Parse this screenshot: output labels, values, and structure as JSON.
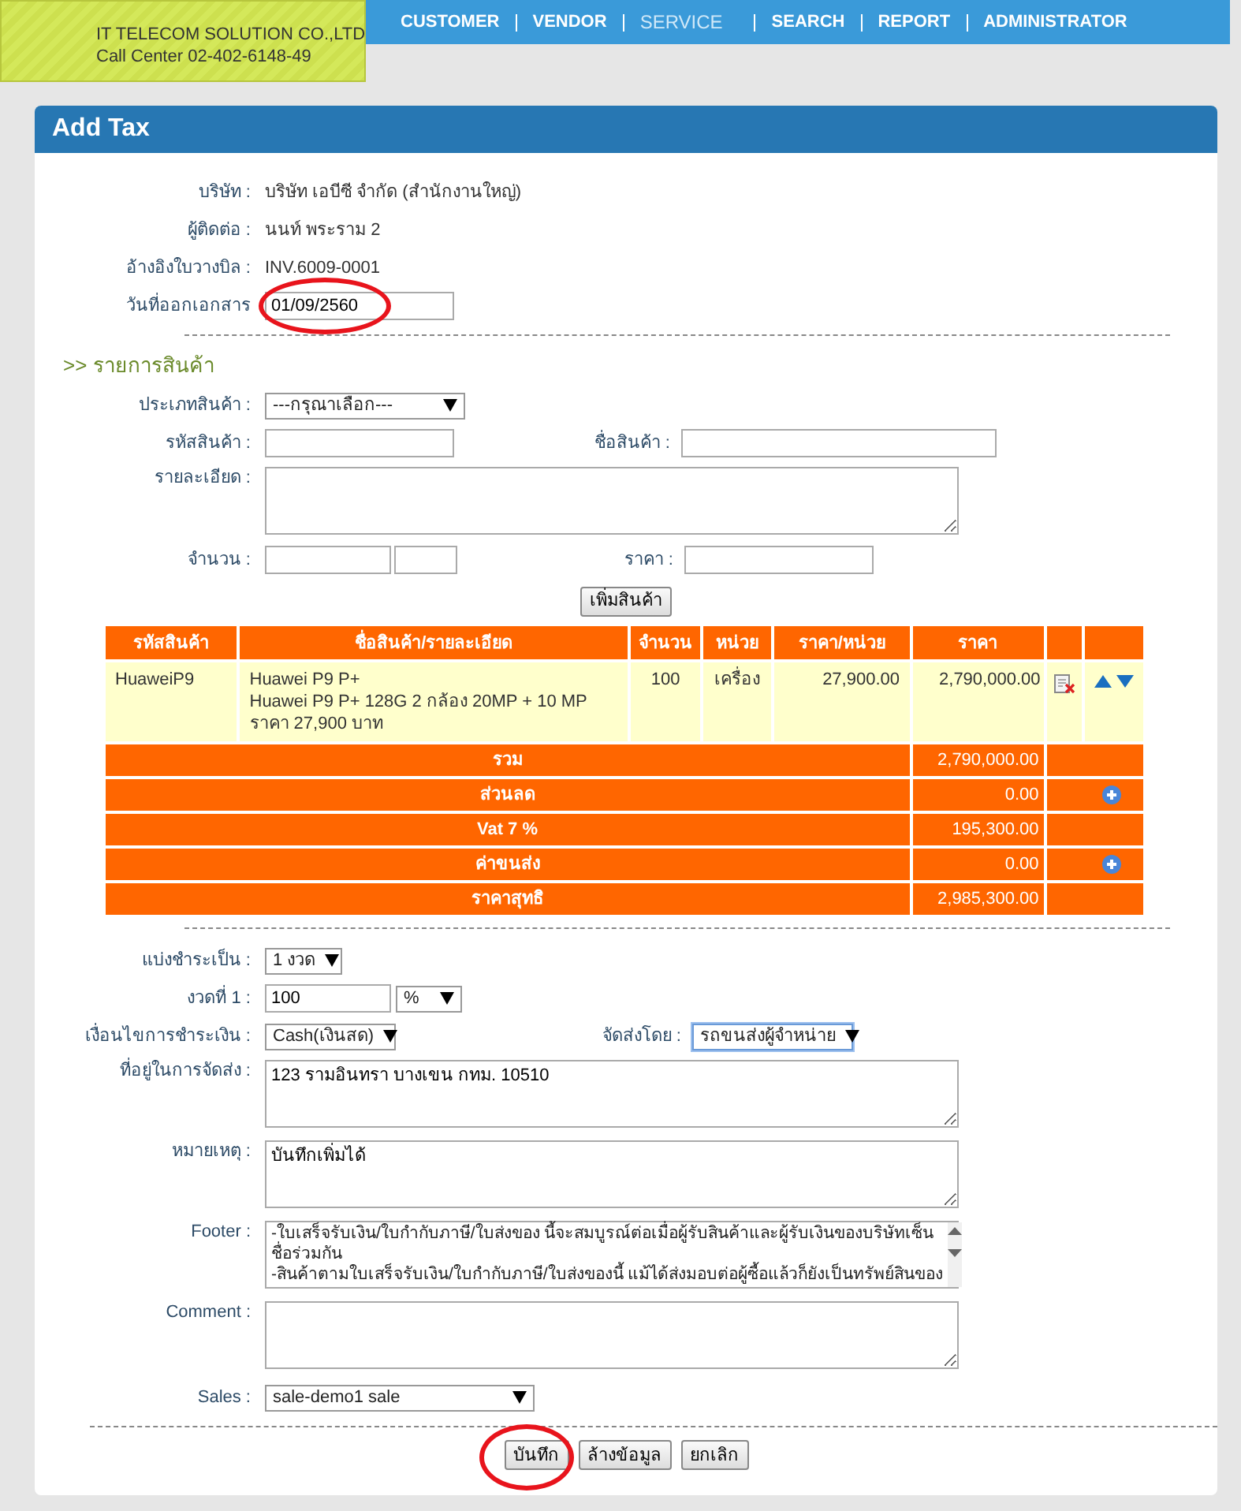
{
  "header": {
    "company_lines": [
      "IT TELECOM SOLUTION CO.,LTD",
      "Call Center 02-402-6148-49"
    ],
    "nav": [
      {
        "label": "CUSTOMER",
        "selected": false
      },
      {
        "label": "VENDOR",
        "selected": false
      },
      {
        "label": "SERVICE",
        "selected": true
      },
      {
        "label": "SEARCH",
        "selected": false
      },
      {
        "label": "REPORT",
        "selected": false
      },
      {
        "label": "ADMINISTRATOR",
        "selected": false
      }
    ]
  },
  "panel": {
    "title": "Add Tax"
  },
  "info": [
    {
      "label": "บริษัท :",
      "value": "บริษัท เอบีซี จำกัด (สำนักงานใหญ่)",
      "kind": "text",
      "circled": false
    },
    {
      "label": "ผู้ติดต่อ :",
      "value": "นนท์ พระราม 2",
      "kind": "text",
      "circled": false
    },
    {
      "label": "อ้างอิงใบวางบิล :",
      "value": "INV.6009-0001",
      "kind": "text",
      "circled": false
    },
    {
      "label": "วันที่ออกเอกสาร",
      "value": "01/09/2560",
      "kind": "input",
      "circled": true
    }
  ],
  "section_title": ">> รายการสินค้า",
  "product_form": {
    "type_label": "ประเภทสินค้า :",
    "type_value": "---กรุณาเลือก---",
    "code_label": "รหัสสินค้า :",
    "name_label": "ชื่อสินค้า :",
    "detail_label": "รายละเอียด :",
    "qty_label": "จำนวน :",
    "price_label": "ราคา :",
    "add_button": "เพิ่มสินค้า"
  },
  "table": {
    "columns": [
      "รหัสสินค้า",
      "ชื่อสินค้า/รายละเอียด",
      "จำนวน",
      "หน่วย",
      "ราคา/หน่วย",
      "ราคา"
    ],
    "rows": [
      {
        "code": "HuaweiP9",
        "name_lines": [
          "Huawei P9 P+",
          "Huawei P9 P+ 128G 2 กล้อง 20MP + 10 MP",
          "ราคา 27,900 บาท"
        ],
        "qty": "100",
        "unit": "เครื่อง",
        "unit_price": "27,900.00",
        "price": "2,790,000.00"
      }
    ],
    "summary": [
      {
        "label": "รวม",
        "value": "2,790,000.00",
        "addable": false
      },
      {
        "label": "ส่วนลด",
        "value": "0.00",
        "addable": true
      },
      {
        "label": "Vat 7 %",
        "value": "195,300.00",
        "addable": false
      },
      {
        "label": "ค่าขนส่ง",
        "value": "0.00",
        "addable": true
      },
      {
        "label": "ราคาสุทธิ",
        "value": "2,985,300.00",
        "addable": false
      }
    ]
  },
  "payment": {
    "split_label": "แบ่งชำระเป็น :",
    "split_value": "1 งวด",
    "installment_label": "งวดที่ 1 :",
    "installment_value": "100",
    "installment_unit": "%",
    "terms_label": "เงื่อนไขการชำระเงิน :",
    "terms_value": "Cash(เงินสด)",
    "ship_label": "จัดส่งโดย :",
    "ship_value": "รถขนส่งผู้จำหน่าย",
    "address_label": "ที่อยู่ในการจัดส่ง :",
    "address_value": "123 รามอินทรา บางเขน กทม. 10510",
    "note_label": "หมายเหตุ :",
    "note_value": "บันทึกเพิ่มได้",
    "footer_label": "Footer :",
    "footer_lines": [
      "-ใบเสร็จรับเงิน/ใบกำกับภาษี/ใบส่งของ นี้จะสมบูรณ์ต่อเมื่อผู้รับสินค้าและผู้รับเงินของบริษัทเซ็น",
      "ชื่อร่วมกัน",
      "-สินค้าตามใบเสร็จรับเงิน/ใบกำกับภาษี/ใบส่งของนี้ แม้ได้ส่งมอบต่อผู้ซื้อแล้วก็ยังเป็นทรัพย์สินของ"
    ],
    "comment_label": "Comment :",
    "sales_label": "Sales :",
    "sales_value": "sale-demo1 sale"
  },
  "buttons": [
    {
      "label": "บันทึก",
      "circled": true
    },
    {
      "label": "ล้างข้อมูล",
      "circled": false
    },
    {
      "label": "ยกเลิก",
      "circled": false
    }
  ]
}
